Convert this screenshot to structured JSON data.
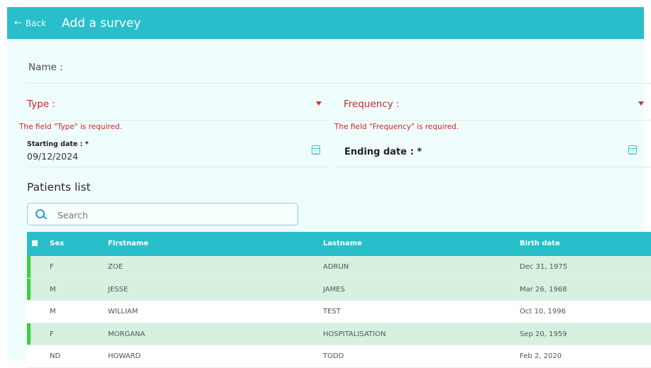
{
  "header": {
    "back_label": "Back",
    "back_icon": "arrow-left-icon",
    "title": "Add a survey",
    "color": "#29bfca"
  },
  "form": {
    "name_label": "Name :",
    "type_label": "Type :",
    "type_error": "The field \"Type\" is required.",
    "frequency_label": "Frequency :",
    "frequency_error": "The field \"Frequency\" is required.",
    "starting_date_label": "Starting date : *",
    "starting_date_value": "09/12/2024",
    "ending_date_label": "Ending date : *",
    "error_color": "#c62828"
  },
  "patients": {
    "title": "Patients list",
    "search_placeholder": "Search",
    "columns": [
      "Sex",
      "Firstname",
      "Lastname",
      "Birth date"
    ],
    "rows": [
      {
        "sex": "F",
        "firstname": "ZOE",
        "lastname": "ADRUN",
        "birth_date": "Dec 31, 1975",
        "highlighted": true
      },
      {
        "sex": "M",
        "firstname": "JESSE",
        "lastname": "JAMES",
        "birth_date": "Mar 26, 1968",
        "highlighted": true
      },
      {
        "sex": "M",
        "firstname": "WILLIAM",
        "lastname": "TEST",
        "birth_date": "Oct 10, 1996",
        "highlighted": false
      },
      {
        "sex": "F",
        "firstname": "MORGANA",
        "lastname": "HOSPITALISATION",
        "birth_date": "Sep 20, 1959",
        "highlighted": true
      },
      {
        "sex": "ND",
        "firstname": "HOWARD",
        "lastname": "TODD",
        "birth_date": "Feb 2, 2020",
        "highlighted": false
      }
    ],
    "highlight_color": "#d7f1e1",
    "marker_color": "#3ad13a"
  }
}
